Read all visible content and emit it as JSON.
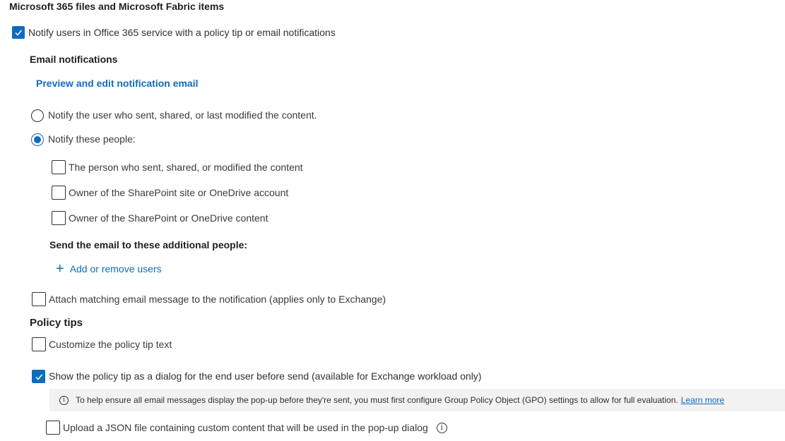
{
  "section": {
    "title": "Microsoft 365 files and Microsoft Fabric items"
  },
  "notify_users": {
    "label": "Notify users in Office 365 service with a policy tip or email notifications",
    "checked": true
  },
  "email_notifications": {
    "heading": "Email notifications",
    "preview_link": "Preview and edit notification email",
    "radio_options": [
      {
        "label": "Notify the user who sent, shared, or last modified the content.",
        "selected": false
      },
      {
        "label": "Notify these people:",
        "selected": true
      }
    ],
    "people_checkboxes": [
      {
        "label": "The person who sent, shared, or modified the content",
        "checked": false
      },
      {
        "label": "Owner of the SharePoint site or OneDrive account",
        "checked": false
      },
      {
        "label": "Owner of the SharePoint or OneDrive content",
        "checked": false
      }
    ],
    "additional_heading": "Send the email to these additional people:",
    "add_users_link": "Add or remove users",
    "attach_label": "Attach matching email message to the notification (applies only to Exchange)",
    "attach_checked": false
  },
  "policy_tips": {
    "heading": "Policy tips",
    "customize_label": "Customize the policy tip text",
    "customize_checked": false,
    "dialog_label": "Show the policy tip as a dialog for the end user before send (available for Exchange workload only)",
    "dialog_checked": true,
    "info_text": "To help ensure all email messages display the pop-up before they're sent, you must first configure Group Policy Object (GPO) settings to allow for full evaluation.",
    "info_link": "Learn more",
    "upload_label": "Upload a JSON file containing custom content that will be used in the pop-up dialog",
    "upload_checked": false
  },
  "colors": {
    "accent": "#0f6cbd",
    "info_bg": "#f3f2f1"
  },
  "icons": {
    "check": "checkmark-icon",
    "plus": "add-icon",
    "info": "info-icon"
  }
}
